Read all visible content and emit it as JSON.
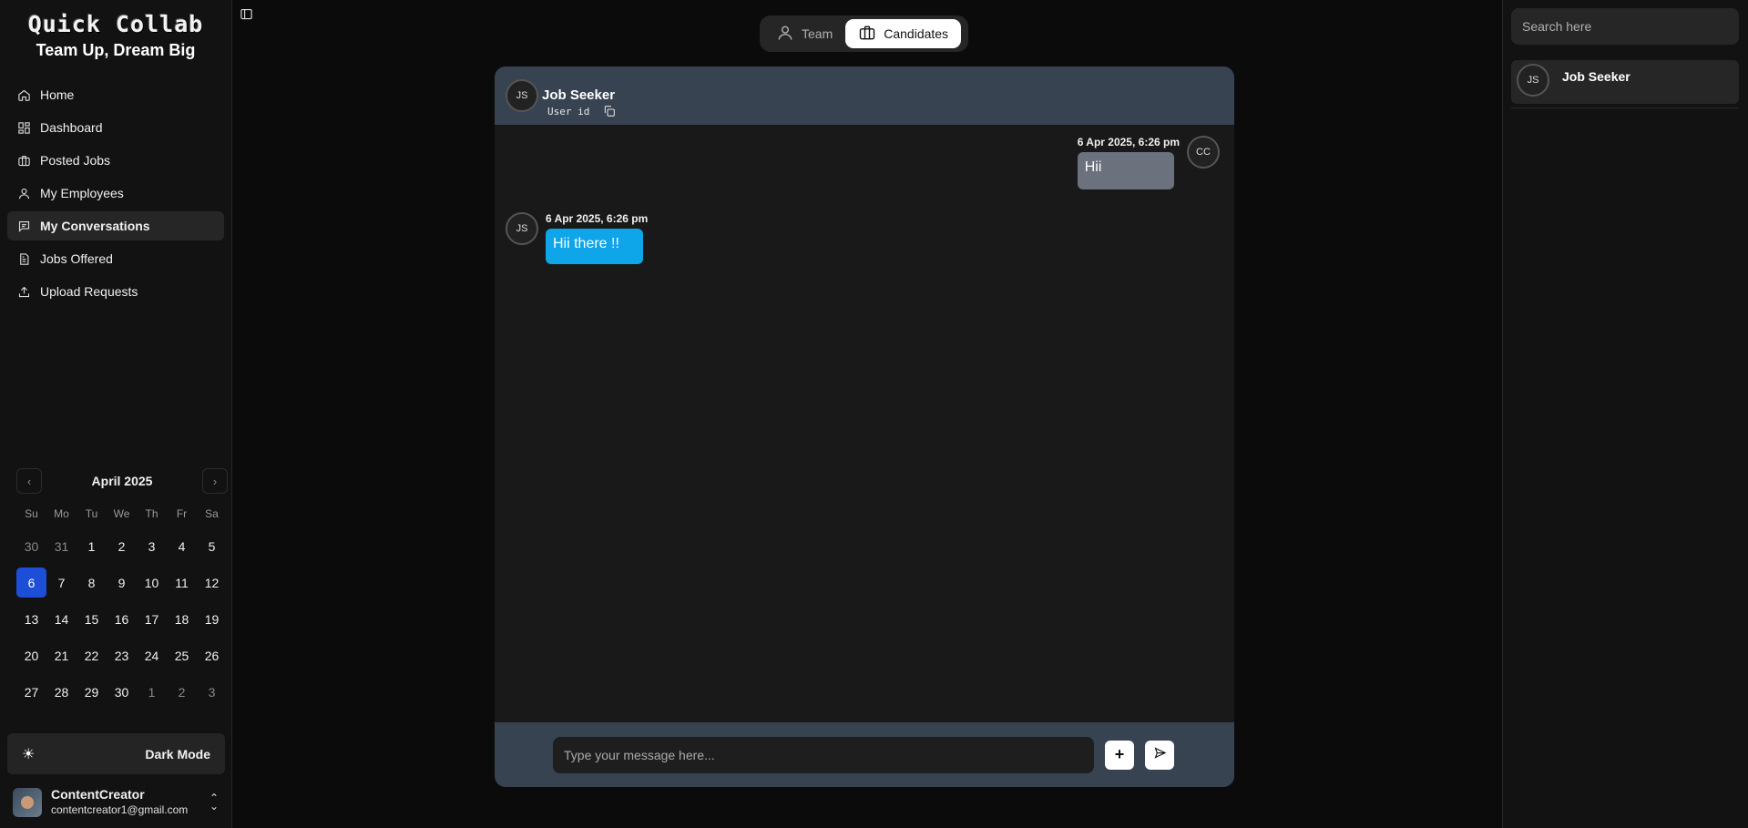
{
  "brand": {
    "title": "Quick Collab",
    "subtitle": "Team Up, Dream Big"
  },
  "sidebar": {
    "items": [
      {
        "label": "Home",
        "icon": "home-icon"
      },
      {
        "label": "Dashboard",
        "icon": "dashboard-icon"
      },
      {
        "label": "Posted Jobs",
        "icon": "briefcase-icon"
      },
      {
        "label": "My Employees",
        "icon": "user-icon"
      },
      {
        "label": "My Conversations",
        "icon": "chat-icon",
        "active": true
      },
      {
        "label": "Jobs Offered",
        "icon": "document-icon"
      },
      {
        "label": "Upload Requests",
        "icon": "upload-icon"
      }
    ]
  },
  "calendar": {
    "month": "April 2025",
    "weekdays": [
      "Su",
      "Mo",
      "Tu",
      "We",
      "Th",
      "Fr",
      "Sa"
    ],
    "days": [
      "30",
      "31",
      "1",
      "2",
      "3",
      "4",
      "5",
      "6",
      "7",
      "8",
      "9",
      "10",
      "11",
      "12",
      "13",
      "14",
      "15",
      "16",
      "17",
      "18",
      "19",
      "20",
      "21",
      "22",
      "23",
      "24",
      "25",
      "26",
      "27",
      "28",
      "29",
      "30",
      "1",
      "2",
      "3"
    ],
    "selected": "6"
  },
  "theme": {
    "label": "Dark Mode"
  },
  "user": {
    "name": "ContentCreator",
    "email": "contentcreator1@gmail.com"
  },
  "tabs": [
    {
      "label": "Team",
      "active": false
    },
    {
      "label": "Candidates",
      "active": true
    }
  ],
  "chat": {
    "contact_initials": "JS",
    "contact_name": "Job Seeker",
    "user_id_label": "User id",
    "messages": [
      {
        "direction": "outgoing",
        "time": "6 Apr 2025, 6:26 pm",
        "text": "Hii",
        "initials": "CC"
      },
      {
        "direction": "incoming",
        "time": "6 Apr 2025, 6:26 pm",
        "text": "Hii there !!",
        "initials": "JS"
      }
    ],
    "composer_placeholder": "Type your message here...",
    "add_label": "+"
  },
  "rightpanel": {
    "search_placeholder": "Search here",
    "contacts": [
      {
        "initials": "JS",
        "name": "Job Seeker"
      }
    ]
  },
  "colors": {
    "accent": "#1d4ed8",
    "incoming_bubble": "#0ea5e9",
    "outgoing_bubble": "#6b717d",
    "header": "#374350"
  }
}
